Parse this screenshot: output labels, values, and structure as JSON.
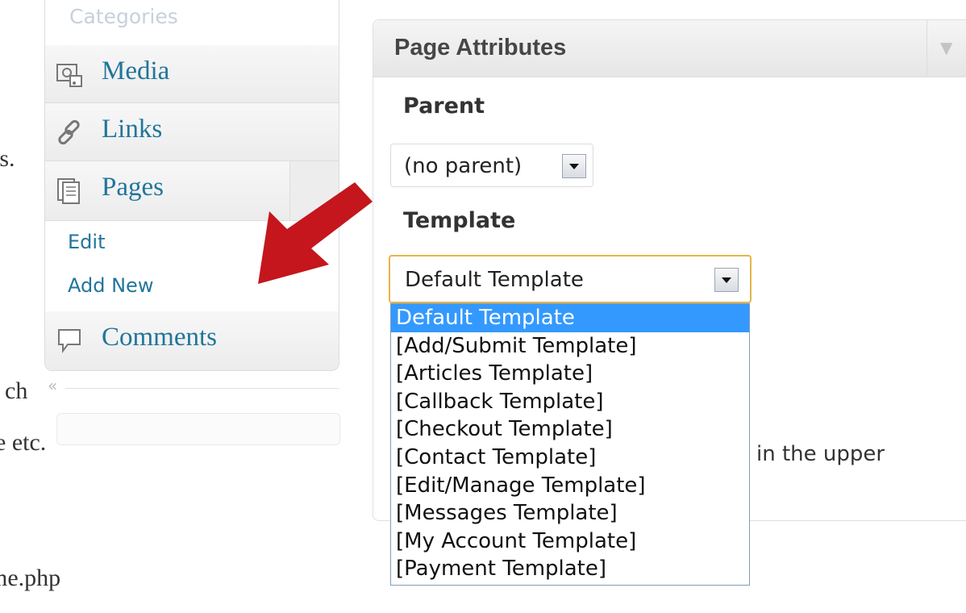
{
  "background_text": {
    "line1": "es.",
    "line2": ".",
    "line3": "ch",
    "line4": "e etc.",
    "line5": "me.php"
  },
  "sidebar": {
    "top_item": "Categories",
    "items": [
      {
        "label": "Media",
        "icon": "media-icon"
      },
      {
        "label": "Links",
        "icon": "links-icon"
      },
      {
        "label": "Pages",
        "icon": "pages-icon"
      },
      {
        "label": "Comments",
        "icon": "comments-icon"
      }
    ],
    "pages_submenu": [
      "Edit",
      "Add New"
    ],
    "collapse_glyph": "«"
  },
  "page_attributes": {
    "title": "Page Attributes",
    "toggle_glyph": "▼",
    "parent_label": "Parent",
    "parent_value": "(no parent)",
    "template_label": "Template",
    "template_value": "Default Template",
    "template_options": [
      "Default Template",
      "[Add/Submit Template]",
      "[Articles Template]",
      "[Callback Template]",
      "[Checkout Template]",
      "[Contact Template]",
      "[Edit/Manage Template]",
      "[Messages Template]",
      "[My Account Template]",
      "[Payment Template]"
    ],
    "selected_option_index": 0,
    "help_text_fragment": "in the upper"
  },
  "colors": {
    "link_blue": "#21759b",
    "selection_blue": "#3399ff",
    "arrow_red": "#c4161c",
    "focus_border": "#e7b44a"
  }
}
